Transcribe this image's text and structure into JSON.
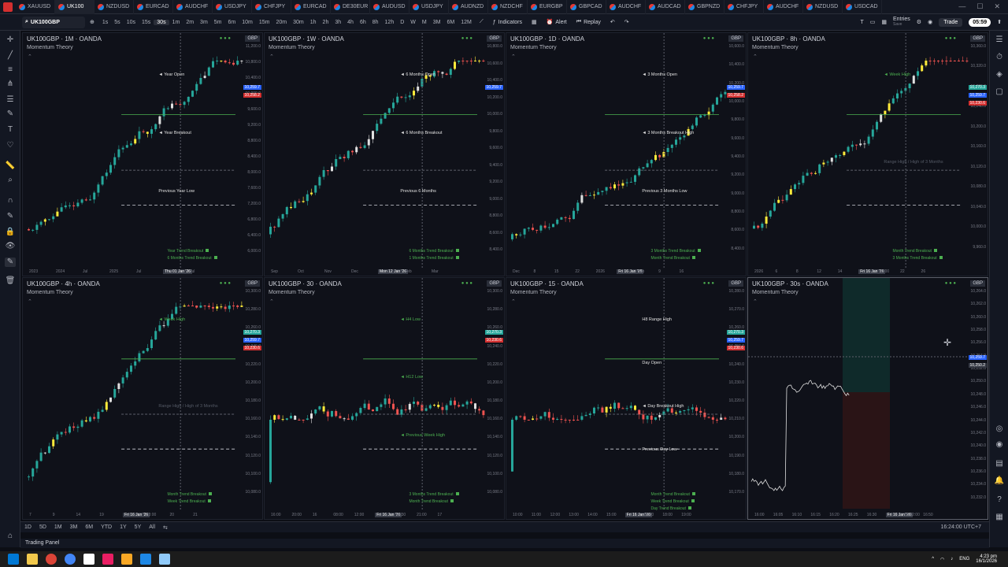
{
  "tabs": [
    {
      "label": "XAUUSD",
      "active": false
    },
    {
      "label": "UK100",
      "active": true
    },
    {
      "label": "NZDUSD",
      "active": false
    },
    {
      "label": "EURCAD",
      "active": false
    },
    {
      "label": "AUDCHF",
      "active": false
    },
    {
      "label": "USDJPY",
      "active": false
    },
    {
      "label": "CHFJPY",
      "active": false
    },
    {
      "label": "EURCAD",
      "active": false
    },
    {
      "label": "DE30EUR",
      "active": false
    },
    {
      "label": "AUDUSD",
      "active": false
    },
    {
      "label": "USDJPY",
      "active": false
    },
    {
      "label": "AUDNZD",
      "active": false
    },
    {
      "label": "NZDCHF",
      "active": false
    },
    {
      "label": "EURGBP",
      "active": false
    },
    {
      "label": "GBPCAD",
      "active": false
    },
    {
      "label": "AUDCHF",
      "active": false
    },
    {
      "label": "AUDCAD",
      "active": false
    },
    {
      "label": "GBPNZD",
      "active": false
    },
    {
      "label": "CHFJPY",
      "active": false
    },
    {
      "label": "AUDCHF",
      "active": false
    },
    {
      "label": "NZDUSD",
      "active": false
    },
    {
      "label": "USDCAD",
      "active": false
    }
  ],
  "toolbar": {
    "symbol": "UK100GBP",
    "timeframes": [
      "1s",
      "5s",
      "10s",
      "15s",
      "30s",
      "1m",
      "2m",
      "3m",
      "5m",
      "6m",
      "10m",
      "15m",
      "20m",
      "30m",
      "1h",
      "2h",
      "3h",
      "4h",
      "6h",
      "8h",
      "12h",
      "D",
      "W",
      "M",
      "3M",
      "6M",
      "12M"
    ],
    "active_tf": "30s",
    "indicators": "Indicators",
    "alert": "Alert",
    "replay": "Replay",
    "entries": "Entries",
    "entries_sub": "Save",
    "trade": "Trade",
    "clock": "05:59"
  },
  "panes": [
    {
      "title": "UK100GBP · 1M · OANDA",
      "indicator": "Momentum Theory",
      "gbp": "GBP",
      "yticks": [
        "11,200.0",
        "10,800.0",
        "10,400.0",
        "10,000.0",
        "9,600.0",
        "9,200.0",
        "8,800.0",
        "8,400.0",
        "8,000.0",
        "7,600.0",
        "7,200.0",
        "6,800.0",
        "6,400.0",
        "6,000.0"
      ],
      "xticks": [
        "2023",
        "2024",
        "Jul",
        "2025",
        "Jul",
        "Thu 01 Jan '26",
        "Jul"
      ],
      "xhl": 5,
      "annos": [
        {
          "t": "◄ Year Open",
          "c": "white"
        },
        {
          "t": "◄ Year Breakout",
          "c": "white"
        },
        {
          "t": "Previous Year Low",
          "c": "white"
        }
      ],
      "legends": [
        "Year Trend Breakout",
        "6 Months Trend Breakout"
      ],
      "price_tags": [
        {
          "v": "10,259.7",
          "c": "#2962ff"
        },
        {
          "v": "10,258.2",
          "c": "#d32f2f"
        }
      ]
    },
    {
      "title": "UK100GBP · 1W · OANDA",
      "indicator": "Momentum Theory",
      "gbp": "GBP",
      "yticks": [
        "10,800.0",
        "10,600.0",
        "10,400.0",
        "10,200.0",
        "10,000.0",
        "9,800.0",
        "9,600.0",
        "9,400.0",
        "9,200.0",
        "9,000.0",
        "8,800.0",
        "8,600.0",
        "8,400.0"
      ],
      "xticks": [
        "Sep",
        "Oct",
        "Nov",
        "Dec",
        "Mon 12 Jan '26",
        "Feb",
        "Mar"
      ],
      "xhl": 4,
      "annos": [
        {
          "t": "◄ 6 Months Open",
          "c": "white"
        },
        {
          "t": "◄ 6 Months Breakout",
          "c": "white"
        },
        {
          "t": "Previous 6 Months",
          "c": "white"
        }
      ],
      "legends": [
        "6 Months Trend Breakout",
        "1 Months Trend Breakout"
      ],
      "price_tags": [
        {
          "v": "10,259.7",
          "c": "#2962ff"
        }
      ]
    },
    {
      "title": "UK100GBP · 1D · OANDA",
      "indicator": "Momentum Theory",
      "gbp": "GBP",
      "yticks": [
        "10,600.0",
        "10,400.0",
        "10,200.0",
        "10,000.0",
        "9,800.0",
        "9,600.0",
        "9,400.0",
        "9,200.0",
        "9,000.0",
        "8,800.0",
        "8,600.0",
        "8,400.0"
      ],
      "xticks": [
        "Dec",
        "8",
        "15",
        "22",
        "2026",
        "Fri 16 Jan '26",
        "Feb",
        "9",
        "16"
      ],
      "xhl": 5,
      "annos": [
        {
          "t": "◄ 3 Months Open",
          "c": "white"
        },
        {
          "t": "◄ 3 Months Breakout High",
          "c": "white"
        },
        {
          "t": "Previous 3 Months Low",
          "c": "white"
        }
      ],
      "legends": [
        "3 Months Trend Breakout",
        "Month Trend Breakout"
      ],
      "price_tags": [
        {
          "v": "10,259.7",
          "c": "#2962ff"
        },
        {
          "v": "10,258.2",
          "c": "#d32f2f"
        }
      ]
    },
    {
      "title": "UK100GBP · 8h · OANDA",
      "indicator": "Momentum Theory",
      "gbp": "GBP",
      "yticks": [
        "10,360.0",
        "10,320.0",
        "10,280.0",
        "10,240.0",
        "10,200.0",
        "10,160.0",
        "10,120.0",
        "10,080.0",
        "10,040.0",
        "10,000.0",
        "9,960.0"
      ],
      "xticks": [
        "2026",
        "6",
        "8",
        "12",
        "14",
        "Fri 16 Jan '26",
        "13:00",
        "22",
        "26"
      ],
      "xhl": 5,
      "annos": [
        {
          "t": "◄ Week High",
          "c": "green"
        },
        {
          "t": "Range High / High of 3 Months",
          "c": "dim"
        }
      ],
      "legends": [
        "Month Trend Breakout",
        "3 Months Trend Breakout"
      ],
      "price_tags": [
        {
          "v": "10,270.3",
          "c": "#26a69a"
        },
        {
          "v": "10,259.7",
          "c": "#2962ff"
        },
        {
          "v": "10,230.6",
          "c": "#d32f2f"
        }
      ]
    },
    {
      "title": "UK100GBP · 4h · OANDA",
      "indicator": "Momentum Theory",
      "gbp": "GBP",
      "yticks": [
        "10,300.0",
        "10,280.0",
        "10,260.0",
        "10,240.0",
        "10,220.0",
        "10,200.0",
        "10,180.0",
        "10,160.0",
        "10,140.0",
        "10,120.0",
        "10,100.0",
        "10,080.0"
      ],
      "xticks": [
        "7",
        "9",
        "14",
        "19",
        "Fri 16 Jan '26",
        "13:00",
        "20",
        "21"
      ],
      "xhl": 4,
      "annos": [
        {
          "t": "◄ Week High",
          "c": "green"
        },
        {
          "t": "Range High / High of 3 Months",
          "c": "dim"
        }
      ],
      "legends": [
        "Month Trend Breakout",
        "Week Trend Breakout"
      ],
      "price_tags": [
        {
          "v": "10,270.3",
          "c": "#26a69a"
        },
        {
          "v": "10,259.7",
          "c": "#2962ff"
        },
        {
          "v": "10,230.6",
          "c": "#d32f2f"
        }
      ]
    },
    {
      "title": "UK100GBP · 30 · OANDA",
      "indicator": "Momentum Theory",
      "gbp": "GBP",
      "yticks": [
        "10,300.0",
        "10,280.0",
        "10,260.0",
        "10,240.0",
        "10,220.0",
        "10,200.0",
        "10,180.0",
        "10,160.0",
        "10,140.0",
        "10,120.0",
        "10,100.0",
        "10,080.0"
      ],
      "xticks": [
        "16:00",
        "20:00",
        "16",
        "08:00",
        "12:00",
        "Fri 16 Jan '26",
        "16:30",
        "21:00",
        "17"
      ],
      "xhl": 5,
      "annos": [
        {
          "t": "◄ H4 Low",
          "c": "green"
        },
        {
          "t": "◄ H12 Low",
          "c": "green"
        },
        {
          "t": "◄ Previous Week High",
          "c": "green"
        }
      ],
      "legends": [
        "3 Months Trend Breakout",
        "Month Trend Breakout"
      ],
      "price_tags": [
        {
          "v": "10,270.3",
          "c": "#26a69a"
        },
        {
          "v": "10,230.6",
          "c": "#d32f2f"
        }
      ]
    },
    {
      "title": "UK100GBP · 15 · OANDA",
      "indicator": "Momentum Theory",
      "gbp": "GBP",
      "yticks": [
        "10,280.0",
        "10,270.0",
        "10,260.0",
        "10,250.0",
        "10,240.0",
        "10,230.0",
        "10,220.0",
        "10,210.0",
        "10,200.0",
        "10,190.0",
        "10,180.0",
        "10,170.0"
      ],
      "xticks": [
        "10:00",
        "11:00",
        "12:00",
        "13:00",
        "14:00",
        "15:00",
        "Fri 16 Jan '26",
        "16:30",
        "18:00",
        "19:00"
      ],
      "xhl": 6,
      "annos": [
        {
          "t": "H8 Range High",
          "c": "white"
        },
        {
          "t": "Day Open",
          "c": "white"
        },
        {
          "t": "◄ Day Breakout High",
          "c": "white"
        },
        {
          "t": "Previous Day Low",
          "c": "white"
        }
      ],
      "legends": [
        "Month Trend Breakout",
        "Week Trend Breakout",
        "Day Trend Breakout"
      ],
      "price_tags": [
        {
          "v": "10,270.3",
          "c": "#26a69a"
        },
        {
          "v": "10,259.7",
          "c": "#2962ff"
        },
        {
          "v": "10,230.6",
          "c": "#d32f2f"
        }
      ]
    },
    {
      "title": "UK100GBP · 30s · OANDA",
      "indicator": "Momentum Theory",
      "gbp": "GBP",
      "yticks": [
        "10,264.0",
        "10,262.0",
        "10,260.0",
        "10,258.0",
        "10,256.0",
        "10,254.0",
        "10,252.0",
        "10,250.0",
        "10,248.0",
        "10,246.0",
        "10,244.0",
        "10,242.0",
        "10,240.0",
        "10,238.0",
        "10,236.0",
        "10,234.0",
        "10,232.0"
      ],
      "xticks": [
        "16:00",
        "16:05",
        "16:10",
        "16:15",
        "16:20",
        "16:25",
        "16:30",
        "Fri 16 Jan '26",
        "16:42:00",
        "16:50"
      ],
      "xhl": 7,
      "annos": [],
      "legends": [],
      "price_tags": [
        {
          "v": "10,259.7",
          "c": "#2962ff"
        },
        {
          "v": "10,250.2",
          "c": "#363a45"
        }
      ]
    }
  ],
  "bottom": {
    "ranges": [
      "1D",
      "5D",
      "1M",
      "3M",
      "6M",
      "YTD",
      "1Y",
      "5Y",
      "All"
    ],
    "time": "16:24:00 UTC+7"
  },
  "trading_panel": "Trading Panel",
  "taskbar": {
    "lang": "ENG",
    "time": "4:23 pm",
    "date": "16/1/2026"
  },
  "colors": {
    "bg": "#0f1119",
    "up": "#26a69a",
    "down": "#ef5350",
    "yellow": "#ffeb3b",
    "green_line": "#4caf50",
    "white_candle": "#e0e0e0"
  }
}
